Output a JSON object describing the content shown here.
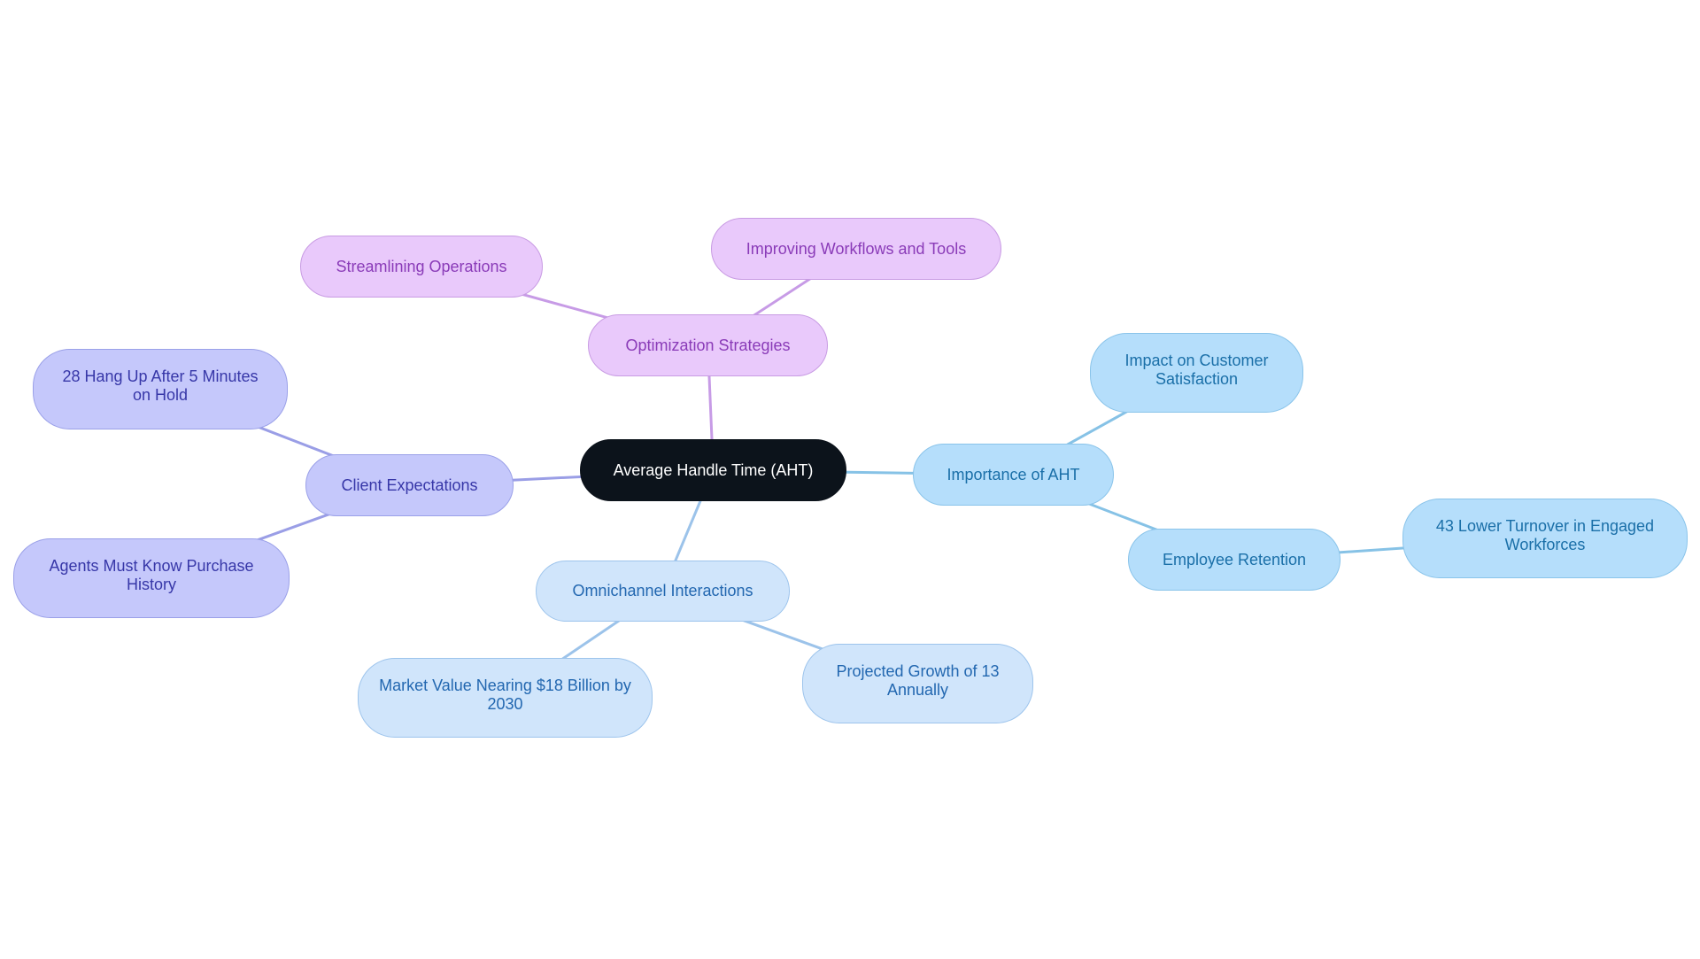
{
  "diagram": {
    "type": "mindmap",
    "root": {
      "id": "aht",
      "label": "Average Handle Time (AHT)"
    },
    "colors": {
      "root_fill": "#0c131b",
      "root_text": "#ffffff",
      "purple_fill": "#e9c9fb",
      "purple_text": "#8a3bb8",
      "purple_line": "#c79be6",
      "indigo_fill": "#c5c8fb",
      "indigo_text": "#3737a8",
      "indigo_line": "#9a9ee6",
      "lightblue_fill": "#d0e5fb",
      "lightblue_text": "#2267b0",
      "lightblue_line": "#9cc3ea",
      "skyblue_fill": "#b5defb",
      "skyblue_text": "#1a6fa8",
      "skyblue_line": "#86c2e6"
    },
    "branches": [
      {
        "id": "optimization",
        "label": "Optimization Strategies",
        "color": "purple",
        "children": [
          {
            "id": "streamlining",
            "label": "Streamlining Operations"
          },
          {
            "id": "improving",
            "label": "Improving Workflows and Tools"
          }
        ]
      },
      {
        "id": "client",
        "label": "Client Expectations",
        "color": "indigo",
        "children": [
          {
            "id": "hangup",
            "label": "28 Hang Up After 5 Minutes on Hold"
          },
          {
            "id": "agents",
            "label": "Agents Must Know Purchase History"
          }
        ]
      },
      {
        "id": "omnichannel",
        "label": "Omnichannel Interactions",
        "color": "lightblue",
        "children": [
          {
            "id": "market",
            "label": "Market Value Nearing $18 Billion by 2030"
          },
          {
            "id": "projected",
            "label": "Projected Growth of 13 Annually"
          }
        ]
      },
      {
        "id": "importance",
        "label": "Importance of AHT",
        "color": "skyblue",
        "children": [
          {
            "id": "impact",
            "label": "Impact on Customer Satisfaction"
          },
          {
            "id": "retention",
            "label": "Employee Retention",
            "children": [
              {
                "id": "turnover",
                "label": "43 Lower Turnover in Engaged Workforces"
              }
            ]
          }
        ]
      }
    ]
  }
}
